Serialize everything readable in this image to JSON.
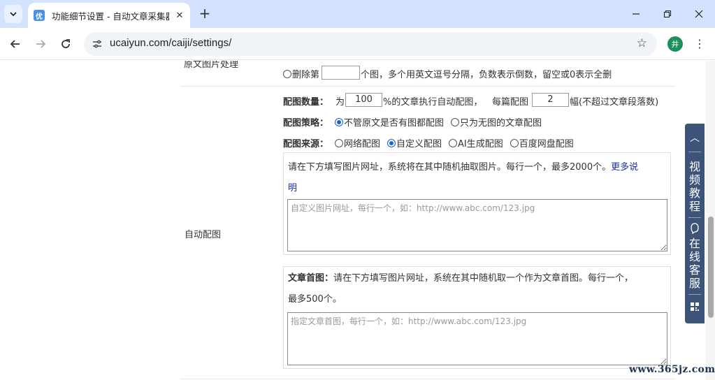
{
  "browser": {
    "tab_title": "功能细节设置 - 自动文章采集器",
    "favicon_text": "优",
    "new_tab": "+",
    "url": "ucaiyun.com/caiji/settings/",
    "profile_initial": "井"
  },
  "form": {
    "original_image_row": {
      "label": "原文图片处理",
      "delete_prefix": "删除第",
      "delete_value": "",
      "delete_suffix": "个图，多个用英文逗号分隔，负数表示倒数，留空或0表示全删"
    },
    "auto_image_row": {
      "label": "自动配图",
      "count_label": "配图数量：",
      "count_prefix": "为",
      "percent_value": "100",
      "count_mid": "%的文章执行自动配图，",
      "per_article_label": "每篇配图",
      "per_article_value": "2",
      "per_article_suffix": "幅(不超过文章段落数)",
      "strategy_label": "配图策略：",
      "strategy_options": [
        "不管原文是否有图都配图",
        "只为无图的文章配图"
      ],
      "strategy_selected": 0,
      "source_label": "配图来源：",
      "source_options": [
        "网络配图",
        "自定义配图",
        "AI生成配图",
        "百度网盘配图"
      ],
      "source_selected": 1,
      "custom_panel": {
        "instruction": "请在下方填写图片网址，系统将在其中随机抽取图片。每行一个，最多2000个。",
        "more_link_part1": "更多说",
        "more_link_part2": "明",
        "textarea_placeholder": "自定义图片网址，每行一个，如：http://www.abc.com/123.jpg"
      },
      "first_image_panel": {
        "label": "文章首图：",
        "instruction_line1": "请在下方填写图片网址，系统在其中随机取一个作为文章首图。每行一个，",
        "instruction_line2": "最多500个。",
        "textarea_placeholder": "指定文章首图，每行一个，如：http://www.abc.com/123.jpg"
      }
    }
  },
  "side_widget": {
    "up_arrow": "︿",
    "video_tutorial": [
      "视",
      "频",
      "教",
      "程"
    ],
    "online_service": [
      "在",
      "线",
      "客",
      "服"
    ]
  },
  "watermark": "www.365jz.com"
}
